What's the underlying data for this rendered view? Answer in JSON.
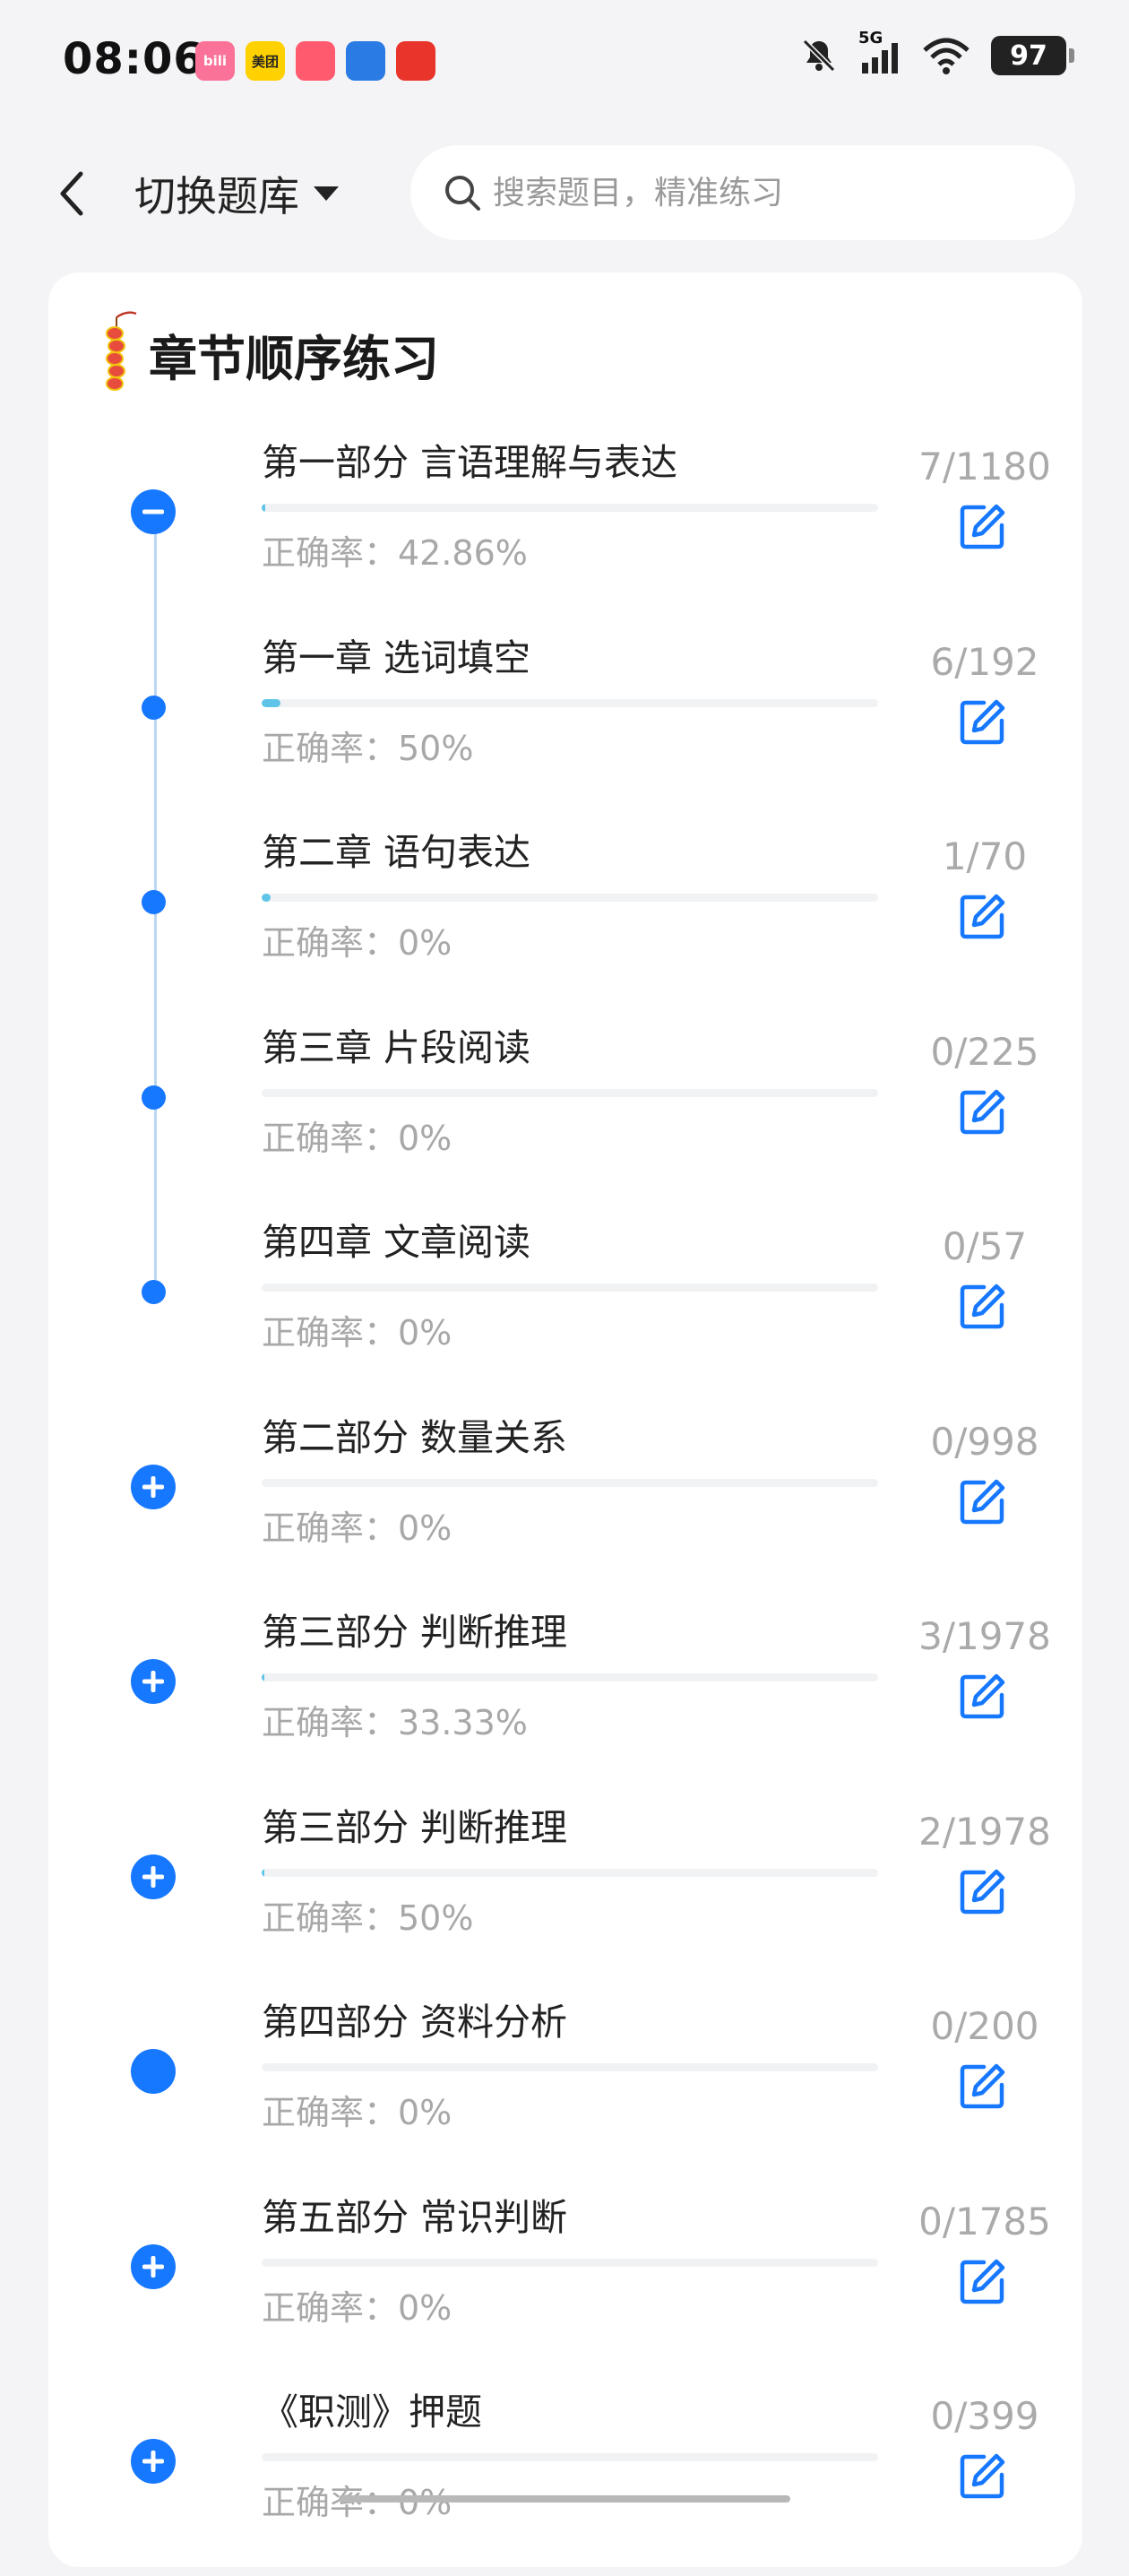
{
  "status_bar": {
    "time": "08:06",
    "app_icons": [
      {
        "name": "bilibili-icon",
        "label": "bili",
        "color": "#fb7299"
      },
      {
        "name": "meituan-icon",
        "label": "美团",
        "color": "#ffd100"
      },
      {
        "name": "triangle-app-icon",
        "label": "",
        "color": "#ff5a6e"
      },
      {
        "name": "blue-app-icon",
        "label": "",
        "color": "#2a7be4"
      },
      {
        "name": "red-app-icon",
        "label": "",
        "color": "#e8342b"
      }
    ],
    "network": "5G",
    "battery": "97"
  },
  "header": {
    "bank_switch_label": "切换题库",
    "search_placeholder": "搜索题目，精准练习"
  },
  "card": {
    "title": "章节顺序练习",
    "accent_color": "#1677ff",
    "rows": [
      {
        "name": "第一部分 言语理解与表达",
        "accuracy": "正确率：42.86%",
        "count": "7/1180",
        "progress": 0.006,
        "marker": "minus",
        "level": 1
      },
      {
        "name": "第一章 选词填空",
        "accuracy": "正确率：50%",
        "count": "6/192",
        "progress": 0.031,
        "marker": "dot",
        "level": 2
      },
      {
        "name": "第二章 语句表达",
        "accuracy": "正确率：0%",
        "count": "1/70",
        "progress": 0.014,
        "marker": "dot",
        "level": 2
      },
      {
        "name": "第三章 片段阅读",
        "accuracy": "正确率：0%",
        "count": "0/225",
        "progress": 0,
        "marker": "dot",
        "level": 2
      },
      {
        "name": "第四章 文章阅读",
        "accuracy": "正确率：0%",
        "count": "0/57",
        "progress": 0,
        "marker": "dot",
        "level": 2
      },
      {
        "name": "第二部分 数量关系",
        "accuracy": "正确率：0%",
        "count": "0/998",
        "progress": 0,
        "marker": "plus",
        "level": 1
      },
      {
        "name": "第三部分 判断推理",
        "accuracy": "正确率：33.33%",
        "count": "3/1978",
        "progress": 0.002,
        "marker": "plus",
        "level": 1
      },
      {
        "name": "第三部分 判断推理",
        "accuracy": "正确率：50%",
        "count": "2/1978",
        "progress": 0.001,
        "marker": "plus",
        "level": 1
      },
      {
        "name": "第四部分 资料分析",
        "accuracy": "正确率：0%",
        "count": "0/200",
        "progress": 0,
        "marker": "filled",
        "level": 1
      },
      {
        "name": "第五部分 常识判断",
        "accuracy": "正确率：0%",
        "count": "0/1785",
        "progress": 0,
        "marker": "plus",
        "level": 1
      },
      {
        "name": "《职测》押题",
        "accuracy": "正确率：0%",
        "count": "0/399",
        "progress": 0,
        "marker": "plus",
        "level": 1
      }
    ]
  }
}
